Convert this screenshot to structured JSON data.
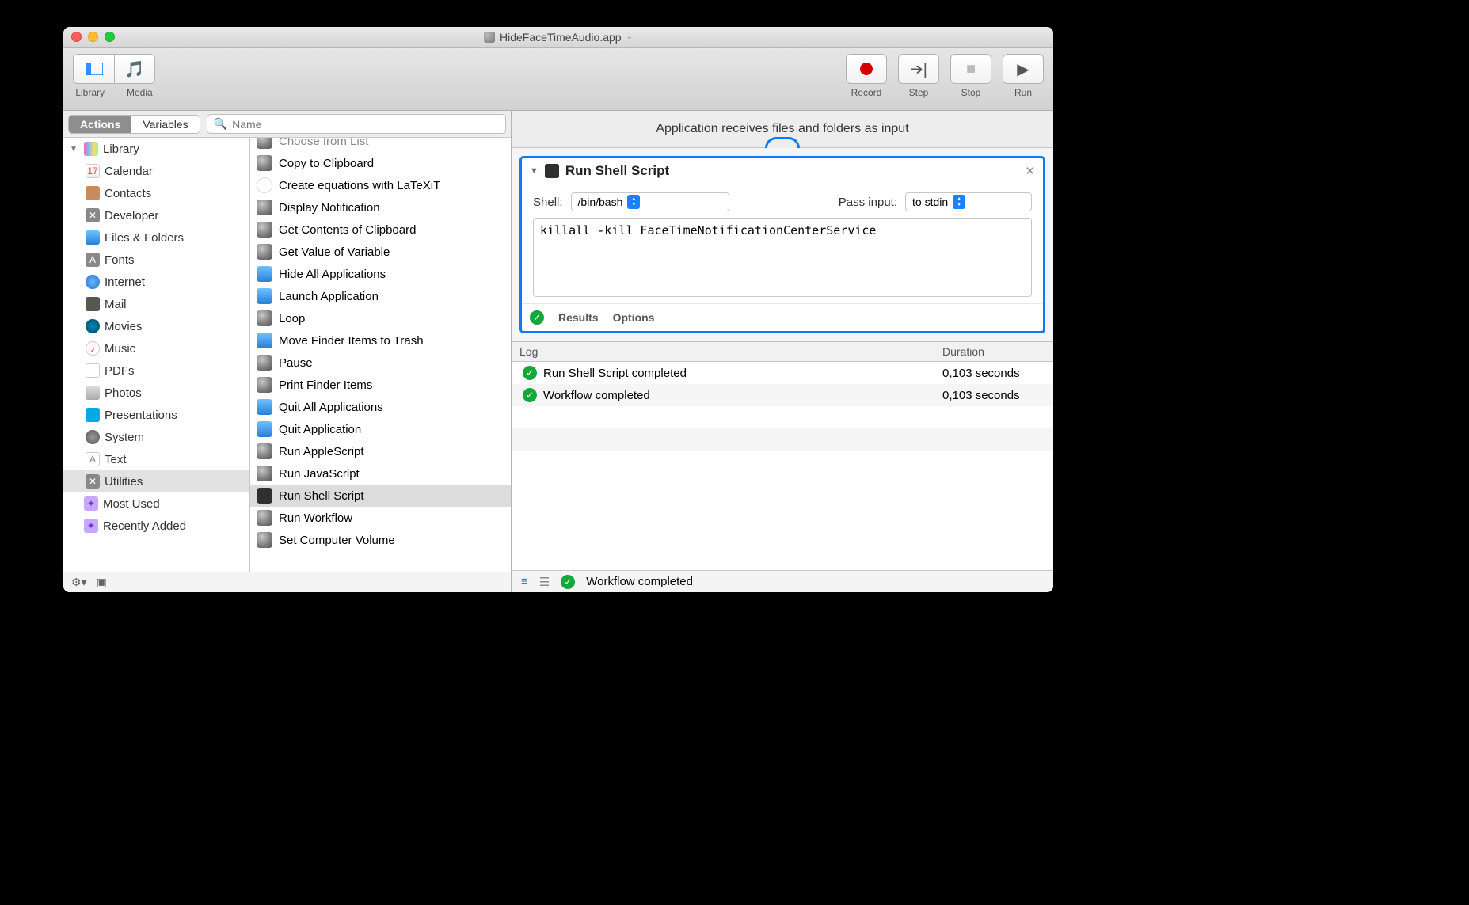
{
  "window": {
    "title": "HideFaceTimeAudio.app"
  },
  "toolbar": {
    "library_label": "Library",
    "media_label": "Media",
    "record_label": "Record",
    "step_label": "Step",
    "stop_label": "Stop",
    "run_label": "Run"
  },
  "left": {
    "seg_actions": "Actions",
    "seg_variables": "Variables",
    "search_placeholder": "Name",
    "footer_gear": "gear",
    "footer_box": "box"
  },
  "library_tree": {
    "root": "Library",
    "items": [
      "Calendar",
      "Contacts",
      "Developer",
      "Files & Folders",
      "Fonts",
      "Internet",
      "Mail",
      "Movies",
      "Music",
      "PDFs",
      "Photos",
      "Presentations",
      "System",
      "Text",
      "Utilities"
    ],
    "selected": "Utilities",
    "extras": [
      "Most Used",
      "Recently Added"
    ]
  },
  "actions": [
    "Choose from List",
    "Copy to Clipboard",
    "Create equations with LaTeXiT",
    "Display Notification",
    "Get Contents of Clipboard",
    "Get Value of Variable",
    "Hide All Applications",
    "Launch Application",
    "Loop",
    "Move Finder Items to Trash",
    "Pause",
    "Print Finder Items",
    "Quit All Applications",
    "Quit Application",
    "Run AppleScript",
    "Run JavaScript",
    "Run Shell Script",
    "Run Workflow",
    "Set Computer Volume"
  ],
  "actions_selected": "Run Shell Script",
  "workflow": {
    "header_text": "Application receives files and folders as input",
    "card": {
      "title": "Run Shell Script",
      "shell_label": "Shell:",
      "shell_value": "/bin/bash",
      "passinput_label": "Pass input:",
      "passinput_value": "to stdin",
      "script": "killall -kill FaceTimeNotificationCenterService",
      "results": "Results",
      "options": "Options"
    }
  },
  "log": {
    "col_log": "Log",
    "col_duration": "Duration",
    "rows": [
      {
        "msg": "Run Shell Script completed",
        "dur": "0,103 seconds"
      },
      {
        "msg": "Workflow completed",
        "dur": "0,103 seconds"
      }
    ],
    "status": "Workflow completed"
  }
}
